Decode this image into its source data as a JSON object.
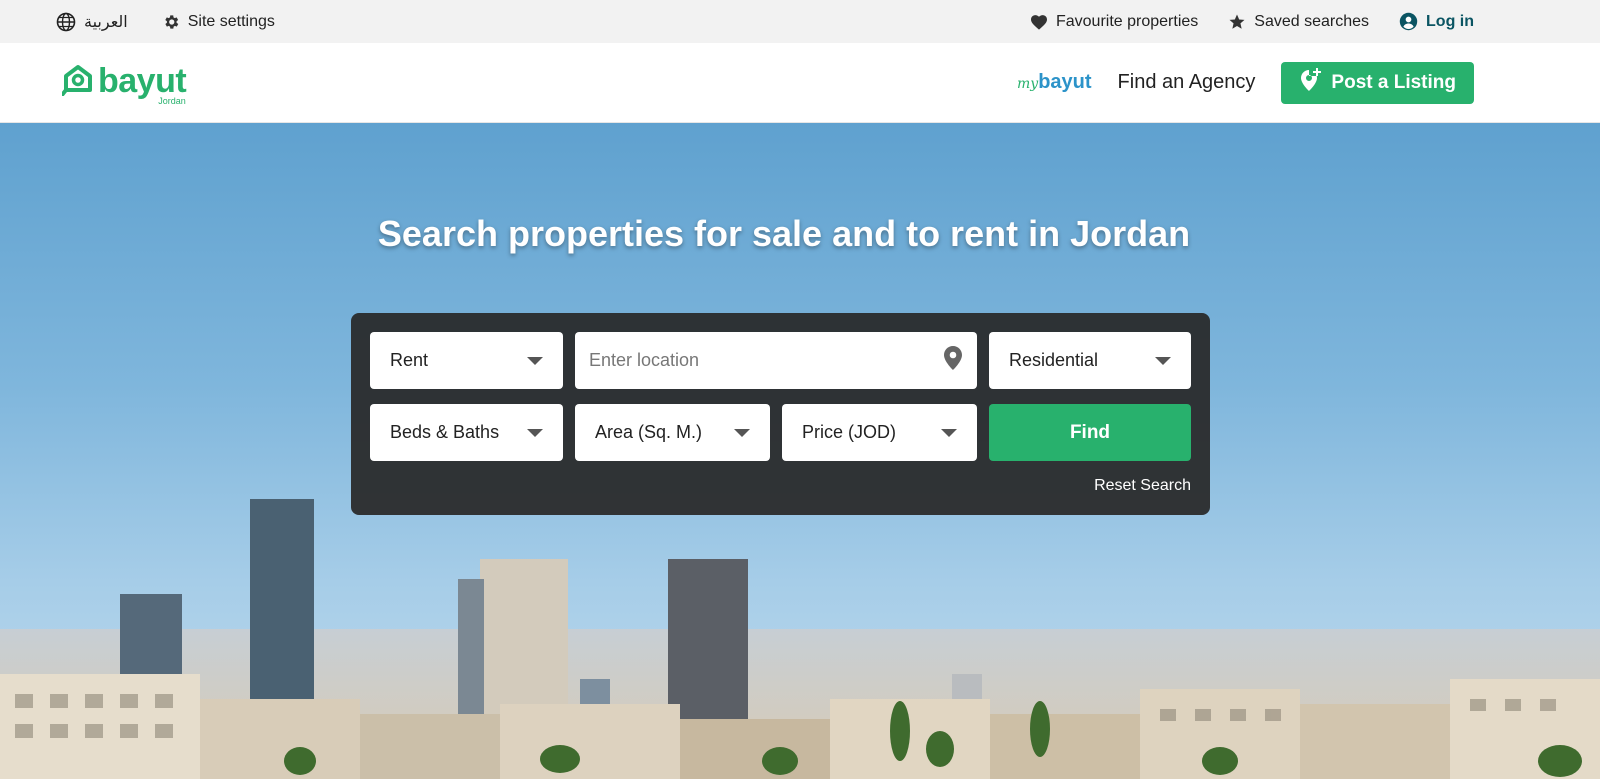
{
  "topbar": {
    "language_label": "العربية",
    "settings_label": "Site settings",
    "favourites_label": "Favourite properties",
    "saved_searches_label": "Saved searches",
    "login_label": "Log in"
  },
  "header": {
    "logo_text": "bayut",
    "logo_subtext": "Jordan",
    "mybayut_my": "my",
    "mybayut_brand": "bayut",
    "find_agency_label": "Find an Agency",
    "post_listing_label": "Post a Listing"
  },
  "hero": {
    "title": "Search properties for sale and to rent in Jordan"
  },
  "search": {
    "purpose_value": "Rent",
    "location_placeholder": "Enter location",
    "category_value": "Residential",
    "beds_baths_label": "Beds & Baths",
    "area_label": "Area (Sq. M.)",
    "price_label": "Price (JOD)",
    "find_label": "Find",
    "reset_label": "Reset Search"
  },
  "colors": {
    "brand_green": "#28b16d",
    "login_teal": "#0b5563",
    "mybayut_blue": "#2c93c9",
    "search_panel": "#282828"
  },
  "icons": [
    "globe-icon",
    "gear-icon",
    "heart-icon",
    "star-icon",
    "user-circle-icon",
    "location-pin-icon",
    "post-listing-icon",
    "caret-down-icon"
  ]
}
